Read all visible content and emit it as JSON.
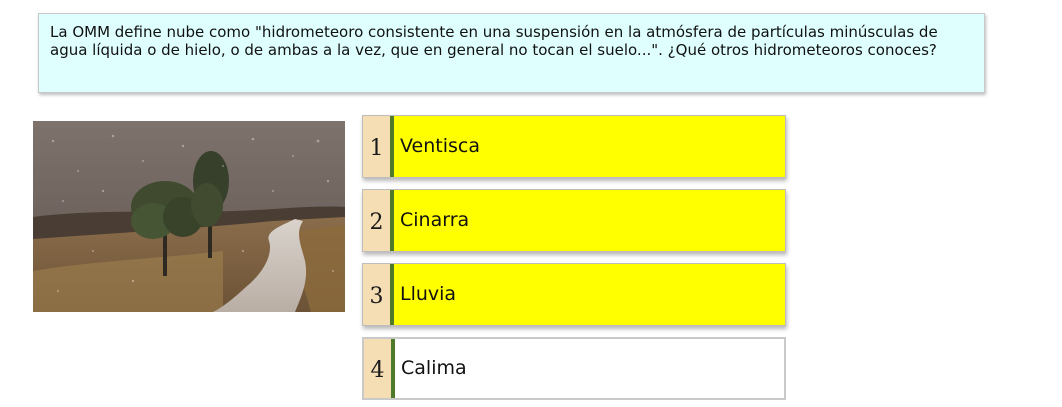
{
  "question": {
    "text": "La OMM define nube como \"hidrometeoro consistente en una suspensión en la atmósfera de partículas minúsculas de agua líquida o de hielo, o de ambas a la vez, que en general no tocan el suelo...\". ¿Qué otros hidrometeoros conoces?"
  },
  "options": [
    {
      "number": "1",
      "label": "Ventisca",
      "color": "#ffff00"
    },
    {
      "number": "2",
      "label": "Cinarra",
      "color": "#ffff00"
    },
    {
      "number": "3",
      "label": "Lluvia",
      "color": "#ffff00"
    },
    {
      "number": "4",
      "label": "Calima",
      "color": "#ffffff"
    }
  ]
}
